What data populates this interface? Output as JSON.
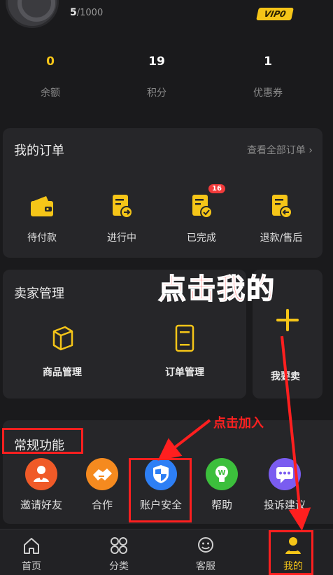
{
  "profile": {
    "level_current": "5",
    "level_total": "/1000",
    "vip": "VIP0"
  },
  "stats": [
    {
      "value": "0",
      "label": "余额"
    },
    {
      "value": "19",
      "label": "积分"
    },
    {
      "value": "1",
      "label": "优惠券"
    }
  ],
  "orders": {
    "title": "我的订单",
    "view_all": "查看全部订单",
    "items": [
      {
        "label": "待付款"
      },
      {
        "label": "进行中"
      },
      {
        "label": "已完成",
        "badge": "16"
      },
      {
        "label": "退款/售后"
      }
    ]
  },
  "seller": {
    "title": "卖家管理",
    "items": [
      {
        "label": "商品管理"
      },
      {
        "label": "订单管理"
      }
    ],
    "sell_label": "我要卖"
  },
  "functions": {
    "title": "常规功能",
    "items": [
      {
        "label": "邀请好友"
      },
      {
        "label": "合作"
      },
      {
        "label": "账户安全"
      },
      {
        "label": "帮助"
      },
      {
        "label": "投诉建议"
      }
    ]
  },
  "tabbar": [
    {
      "label": "首页"
    },
    {
      "label": "分类"
    },
    {
      "label": "客服"
    },
    {
      "label": "我的",
      "active": true
    }
  ],
  "annotations": {
    "big": "点击我的",
    "small": "点击加入"
  },
  "colors": {
    "accent": "#f5c518",
    "annotation": "#ff1f1f",
    "background": "#1a1a1c",
    "card": "#262629"
  }
}
